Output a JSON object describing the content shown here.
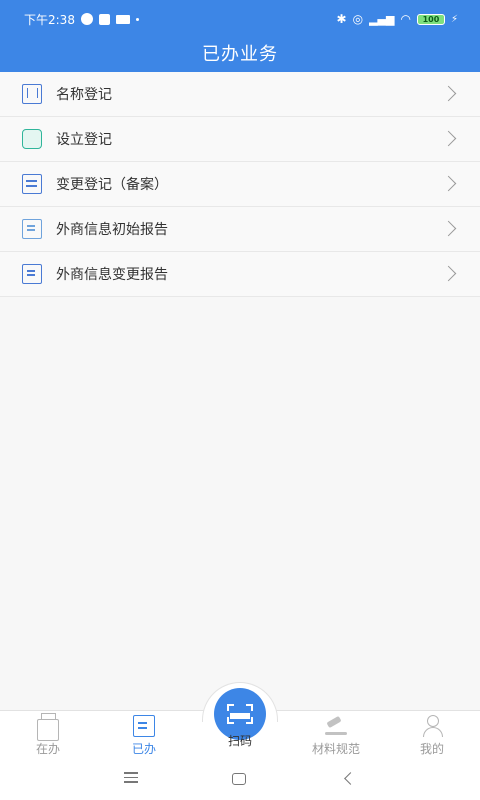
{
  "status_bar": {
    "time": "下午2:38",
    "battery": "100"
  },
  "header": {
    "title": "已办业务"
  },
  "list": {
    "items": [
      {
        "label": "名称登记",
        "icon": "bookmark-icon"
      },
      {
        "label": "设立登记",
        "icon": "chat-icon"
      },
      {
        "label": "变更登记（备案）",
        "icon": "form-icon"
      },
      {
        "label": "外商信息初始报告",
        "icon": "report-doc-icon"
      },
      {
        "label": "外商信息变更报告",
        "icon": "report-doc-icon"
      }
    ]
  },
  "tabbar": {
    "tabs": [
      {
        "label": "在办",
        "icon": "printer-icon",
        "active": false
      },
      {
        "label": "已办",
        "icon": "edit-doc-icon",
        "active": true
      },
      {
        "label": "扫码",
        "icon": "scan-icon",
        "active": false
      },
      {
        "label": "材料规范",
        "icon": "gavel-icon",
        "active": false
      },
      {
        "label": "我的",
        "icon": "user-icon",
        "active": false
      }
    ]
  },
  "colors": {
    "primary": "#3d86e6",
    "background": "#f7f7f7",
    "text": "#333333",
    "inactive": "#9a9a9a"
  }
}
